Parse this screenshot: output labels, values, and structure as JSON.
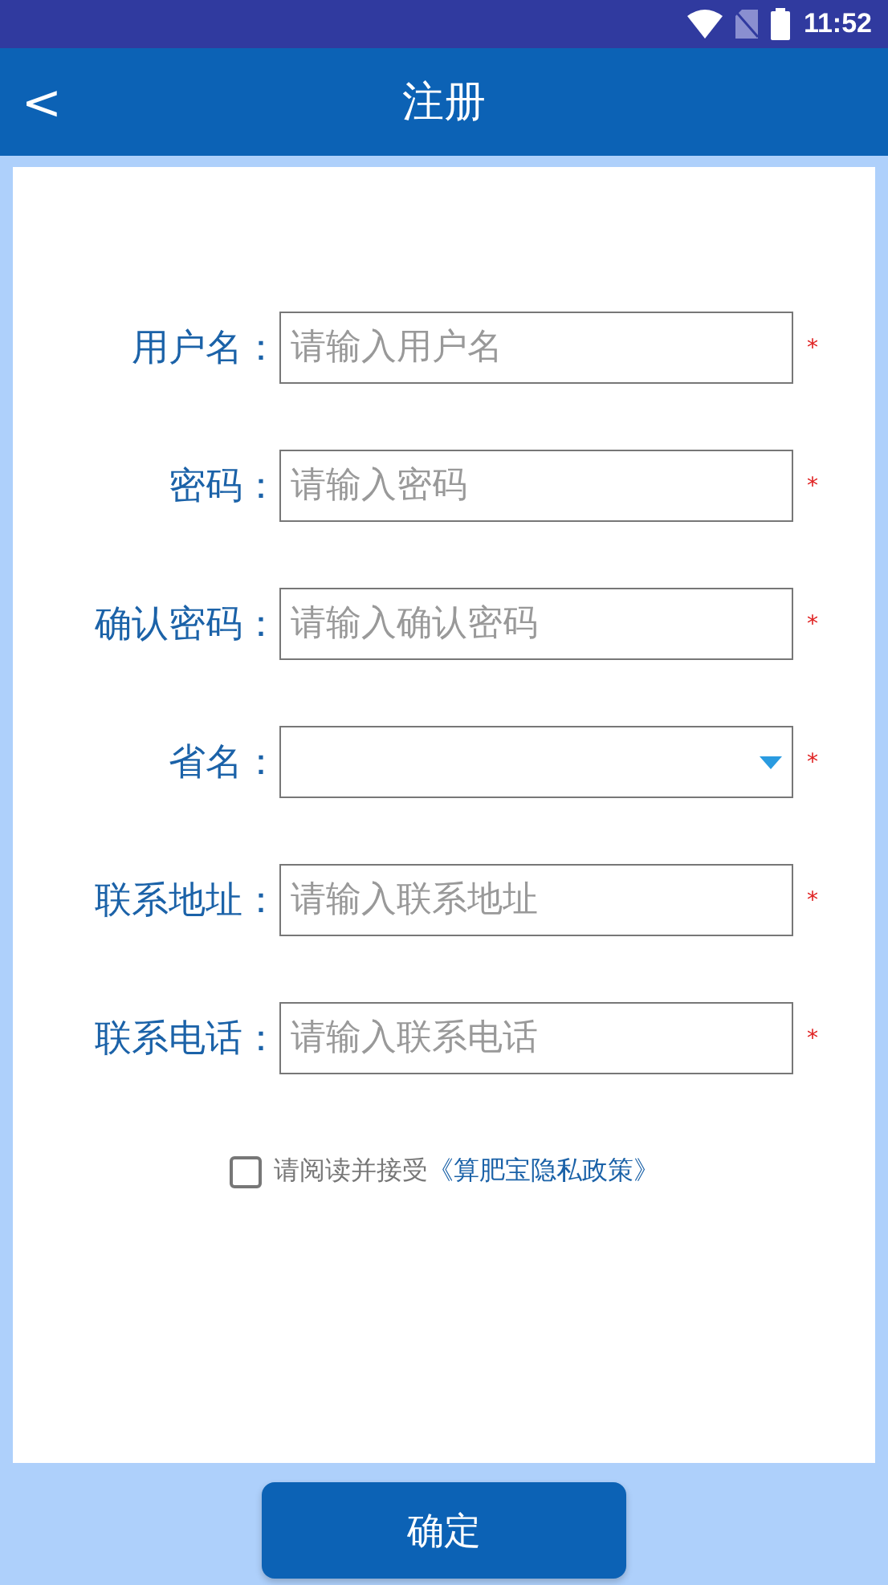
{
  "status_bar": {
    "time": "11:52"
  },
  "header": {
    "back": "<",
    "title": "注册"
  },
  "fields": [
    {
      "kind": "text",
      "label": "用户名：",
      "placeholder": "请输入用户名",
      "required_mark": "*"
    },
    {
      "kind": "text",
      "label": "密码：",
      "placeholder": "请输入密码",
      "required_mark": "*"
    },
    {
      "kind": "text",
      "label": "确认密码：",
      "placeholder": "请输入确认密码",
      "required_mark": "*"
    },
    {
      "kind": "select",
      "label": "省名：",
      "required_mark": "*"
    },
    {
      "kind": "text",
      "label": "联系地址：",
      "placeholder": "请输入联系地址",
      "required_mark": "*"
    },
    {
      "kind": "text",
      "label": "联系电话：",
      "placeholder": "请输入联系电话",
      "required_mark": "*"
    }
  ],
  "agreement": {
    "checked": false,
    "text": "请阅读并接受",
    "link": "《算肥宝隐私政策》"
  },
  "submit": "确定"
}
